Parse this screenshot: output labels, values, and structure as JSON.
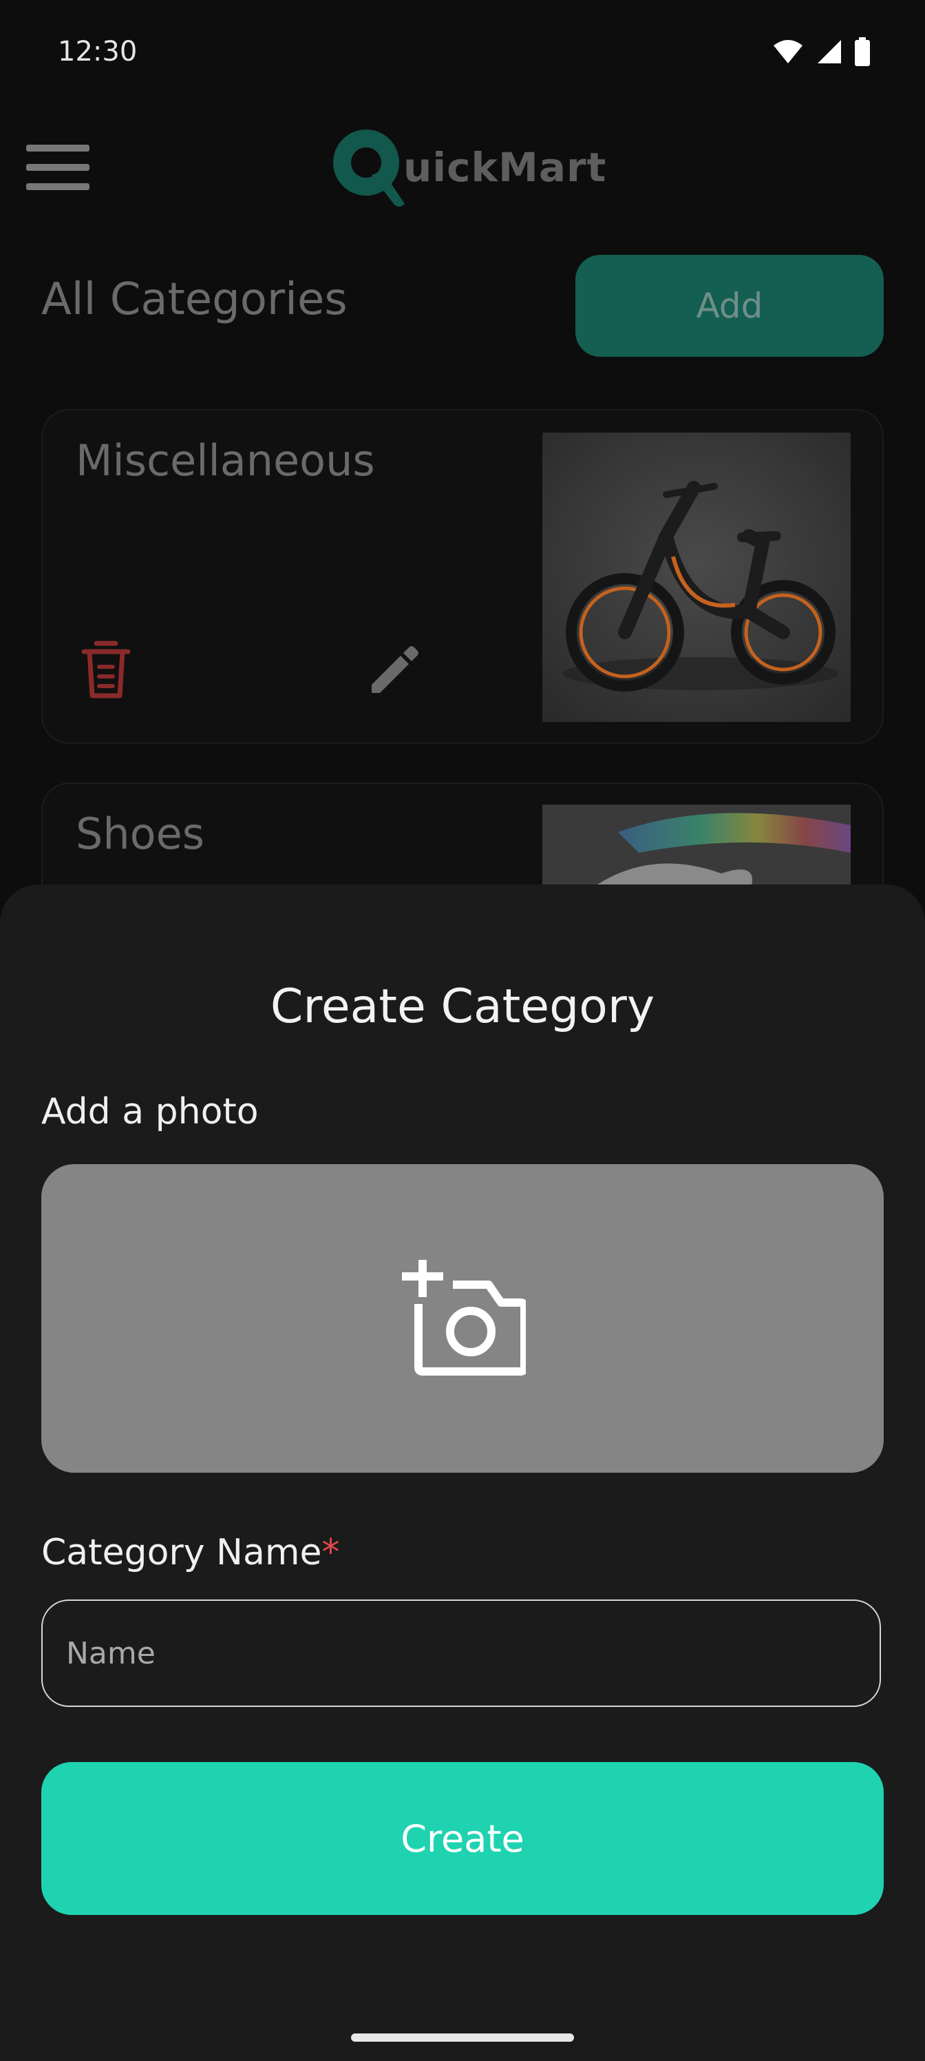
{
  "status_bar": {
    "time": "12:30",
    "icons": [
      "wifi-icon",
      "signal-icon",
      "battery-icon"
    ]
  },
  "app_bar": {
    "logo_letter": "Q",
    "logo_text": "uickMart",
    "menu_icon": "menu-icon"
  },
  "header": {
    "title": "All Categories",
    "add_label": "Add"
  },
  "categories": [
    {
      "name": "Miscellaneous",
      "image": "e-bike-photo",
      "delete_icon": "trash-icon",
      "edit_icon": "pencil-icon"
    },
    {
      "name": "Shoes",
      "image": "sneaker-photo"
    }
  ],
  "sheet": {
    "title": "Create Category",
    "photo_label": "Add a photo",
    "photo_icon": "add-photo-camera-icon",
    "name_label": "Category Name",
    "required_mark": "*",
    "name_placeholder": "Name",
    "name_value": "",
    "create_label": "Create"
  },
  "colors": {
    "accent": "#1fd3b1",
    "accent_dimmed": "#155f52",
    "sheet_background": "#1b1b1b",
    "required": "#e24a4a",
    "delete": "#8a2a2a"
  }
}
